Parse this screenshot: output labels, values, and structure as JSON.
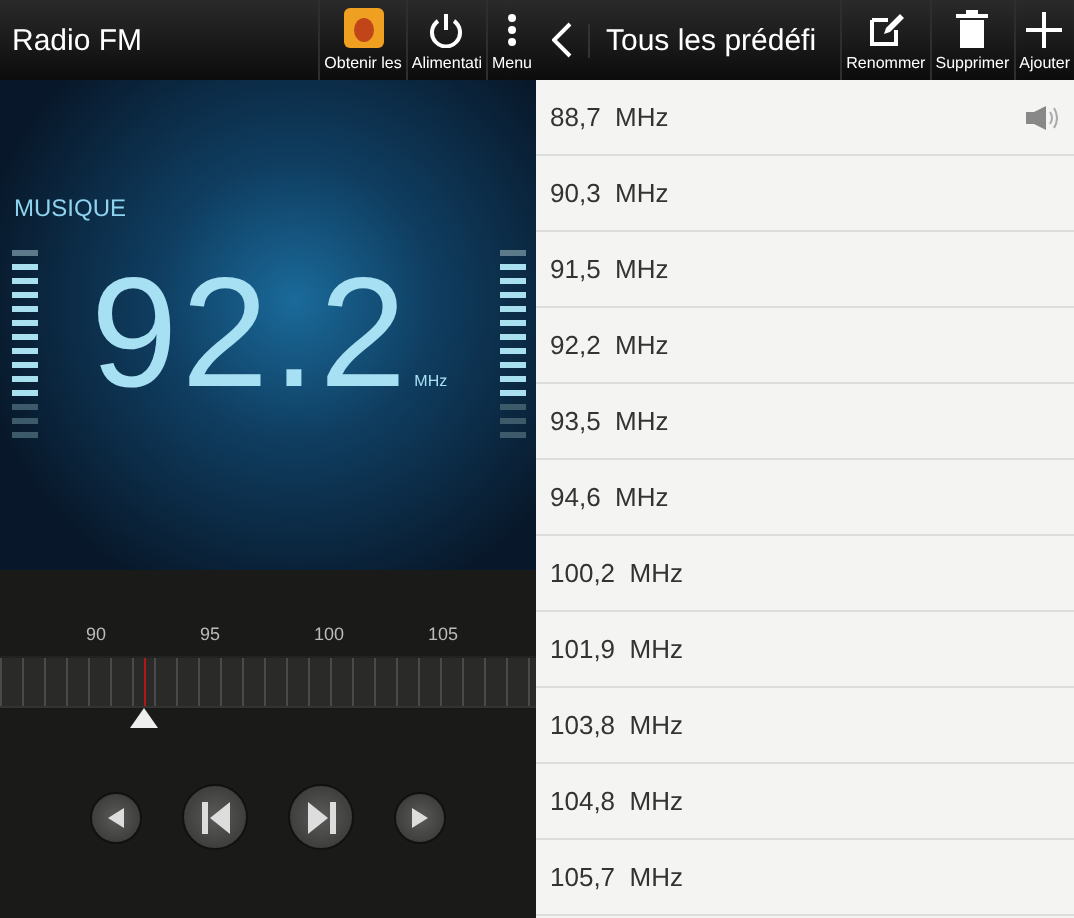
{
  "radio": {
    "title": "Radio FM",
    "actions": [
      {
        "kind": "app",
        "label": "Obtenir les"
      },
      {
        "kind": "power",
        "label": "Alimentati"
      },
      {
        "kind": "menu",
        "label": "Menu"
      }
    ],
    "genre": "MUSIQUE",
    "frequency": "92.2",
    "unit": "MHz",
    "tuner": {
      "ticks": [
        "90",
        "95",
        "100",
        "105"
      ],
      "level": 0.27
    },
    "controls": [
      {
        "kind": "step-back"
      },
      {
        "kind": "seek-back"
      },
      {
        "kind": "seek-forward"
      },
      {
        "kind": "step-forward"
      }
    ]
  },
  "presets": {
    "title": "Tous les prédéfi",
    "actions": [
      {
        "kind": "rename",
        "label": "Renommer"
      },
      {
        "kind": "delete",
        "label": "Supprimer"
      },
      {
        "kind": "add",
        "label": "Ajouter"
      }
    ],
    "stations": [
      {
        "frequency": "88,7  MHz",
        "playing": true
      },
      {
        "frequency": "90,3  MHz",
        "playing": false
      },
      {
        "frequency": "91,5  MHz",
        "playing": false
      },
      {
        "frequency": "92,2  MHz",
        "playing": false
      },
      {
        "frequency": "93,5  MHz",
        "playing": false
      },
      {
        "frequency": "94,6  MHz",
        "playing": false
      },
      {
        "frequency": "100,2  MHz",
        "playing": false
      },
      {
        "frequency": "101,9  MHz",
        "playing": false
      },
      {
        "frequency": "103,8  MHz",
        "playing": false
      },
      {
        "frequency": "104,8  MHz",
        "playing": false
      },
      {
        "frequency": "105,7  MHz",
        "playing": false
      }
    ]
  }
}
